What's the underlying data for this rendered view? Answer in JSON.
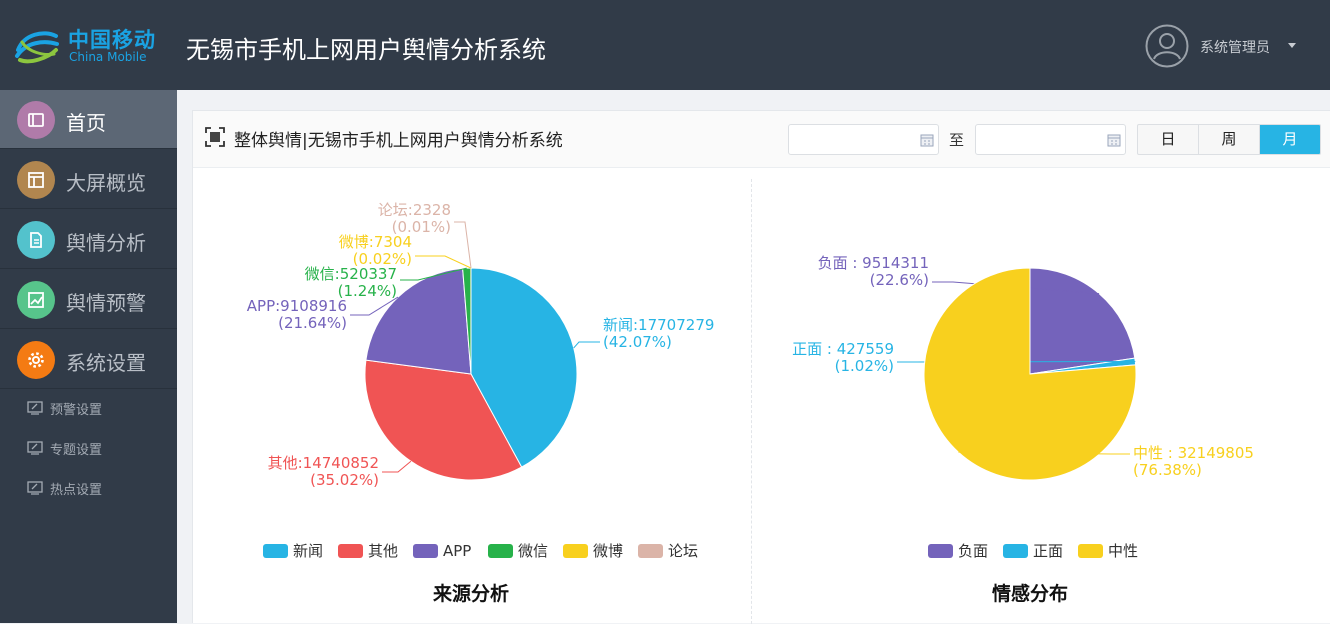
{
  "header": {
    "logo_cn": "中国移动",
    "logo_en": "China Mobile",
    "app_title": "无锡市手机上网用户舆情分析系统",
    "user_name": "系统管理员"
  },
  "sidebar": {
    "items": [
      {
        "label": "首页",
        "color": "#b07ba9",
        "icon": "home-icon"
      },
      {
        "label": "大屏概览",
        "color": "#b1864f",
        "icon": "dashboard-icon"
      },
      {
        "label": "舆情分析",
        "color": "#53c2cc",
        "icon": "document-icon"
      },
      {
        "label": "舆情预警",
        "color": "#57c48b",
        "icon": "chart-icon"
      },
      {
        "label": "系统设置",
        "color": "#f47b13",
        "icon": "gear-icon"
      }
    ],
    "sub_items": [
      {
        "label": "预警设置"
      },
      {
        "label": "专题设置"
      },
      {
        "label": "热点设置"
      }
    ]
  },
  "panel": {
    "title": "整体舆情|无锡市手机上网用户舆情分析系统",
    "date_from": "",
    "date_to": "",
    "to_label": "至",
    "periods": [
      "日",
      "周",
      "月"
    ],
    "active_period": "月"
  },
  "chart_data": [
    {
      "type": "pie",
      "title": "来源分析",
      "slices": [
        {
          "name": "新闻",
          "value": 17707279,
          "percent": "42.07%",
          "color": "#27b4e4"
        },
        {
          "name": "其他",
          "value": 14740852,
          "percent": "35.02%",
          "color": "#f05454"
        },
        {
          "name": "APP",
          "value": 9108916,
          "percent": "21.64%",
          "color": "#7463bb"
        },
        {
          "name": "微信",
          "value": 520337,
          "percent": "1.24%",
          "color": "#27b24a"
        },
        {
          "name": "微博",
          "value": 7304,
          "percent": "0.02%",
          "color": "#f8d01e"
        },
        {
          "name": "论坛",
          "value": 2328,
          "percent": "0.01%",
          "color": "#dbb4a8"
        }
      ],
      "legend": [
        "新闻",
        "其他",
        "APP",
        "微信",
        "微博",
        "论坛"
      ],
      "legend_position": "bottom"
    },
    {
      "type": "pie",
      "title": "情感分布",
      "slices": [
        {
          "name": "负面",
          "value": 9514311,
          "percent": "22.6%",
          "color": "#7463bb"
        },
        {
          "name": "正面",
          "value": 427559,
          "percent": "1.02%",
          "color": "#27b4e4"
        },
        {
          "name": "中性",
          "value": 32149805,
          "percent": "76.38%",
          "color": "#f8d01e"
        }
      ],
      "legend": [
        "负面",
        "正面",
        "中性"
      ],
      "legend_position": "bottom"
    }
  ]
}
